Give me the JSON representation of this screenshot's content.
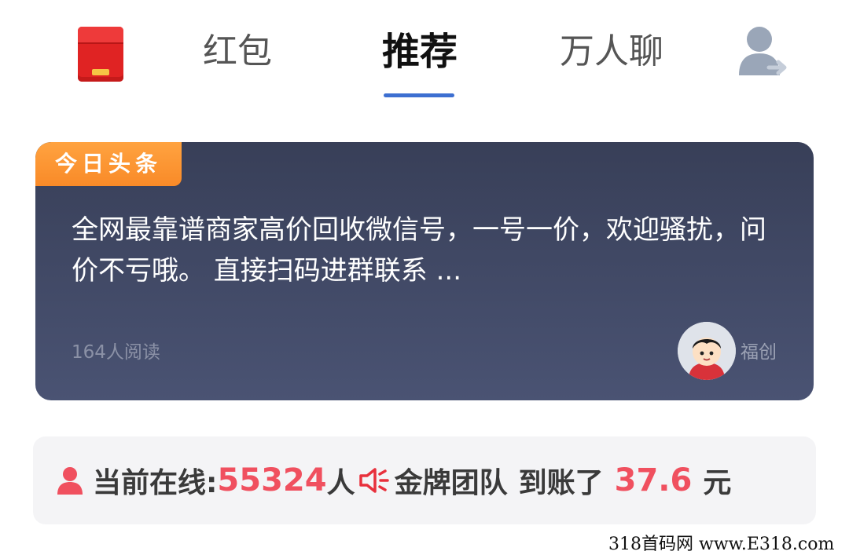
{
  "topnav": {
    "icon_left": "red-packet-icon",
    "tabs": [
      {
        "label": "红包"
      },
      {
        "label": "推荐",
        "active": true
      },
      {
        "label": "万人聊"
      }
    ],
    "icon_right": "user-switch-icon",
    "accent_color": "#3d6fd1"
  },
  "headline": {
    "badge": "今日头条",
    "text": "全网最靠谱商家高价回收微信号，一号一价，欢迎骚扰，问价不亏哦。 直接扫码进群联系 ...",
    "read_count": "164人阅读",
    "author": "福创",
    "badge_color": "#f98a28"
  },
  "online": {
    "label": "当前在线:",
    "count": "55324",
    "count_unit": "人",
    "team": "金牌团队",
    "arrived": "到账了",
    "amount": "37.6",
    "currency": "元",
    "highlight_color": "#f0505f"
  },
  "watermark": "318首码网 www.E318.com"
}
